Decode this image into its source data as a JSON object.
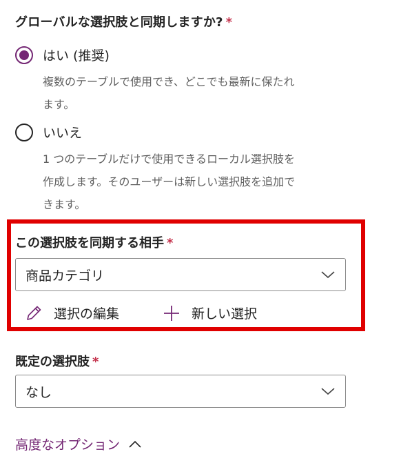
{
  "sync": {
    "question": "グローバルな選択肢と同期しますか?",
    "required_mark": "*",
    "options": [
      {
        "label": "はい (推奨)",
        "description_lines": [
          "複数のテーブルで使用でき、どこでも最新に保たれ",
          "ます。"
        ],
        "selected": true
      },
      {
        "label": "いいえ",
        "description_lines": [
          "1 つのテーブルだけで使用できるローカル選択肢を",
          "作成します。そのユーザーは新しい選択肢を追加で",
          "きます。"
        ],
        "selected": false
      }
    ]
  },
  "sync_with": {
    "label": "この選択肢を同期する相手",
    "required_mark": "*",
    "value": "商品カテゴリ",
    "edit_label": "選択の編集",
    "new_label": "新しい選択"
  },
  "default_choice": {
    "label": "既定の選択肢",
    "required_mark": "*",
    "value": "なし"
  },
  "advanced": {
    "label": "高度なオプション"
  },
  "colors": {
    "accent": "#742774",
    "required": "#c4314b",
    "highlight": "#e00000"
  },
  "icons": {
    "edit": "pencil-icon",
    "add": "plus-icon",
    "dropdown": "chevron-down-icon",
    "collapse": "chevron-up-icon"
  }
}
